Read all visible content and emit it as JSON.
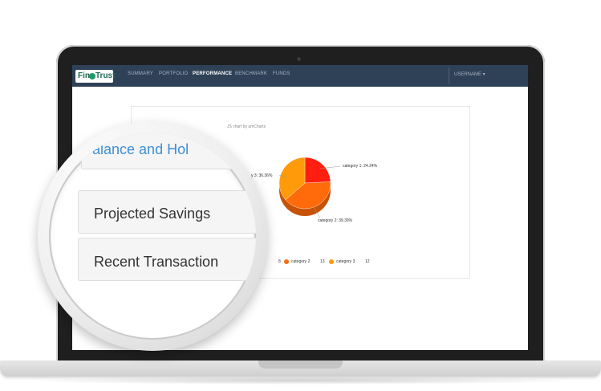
{
  "app": {
    "logo": {
      "left": "Fin",
      "right": "Trust"
    }
  },
  "nav": {
    "items": [
      "SUMMARY",
      "PORTFOLIO",
      "PERFORMANCE",
      "BENCHMARK",
      "FUNDS"
    ],
    "active": "PERFORMANCE",
    "user": "USERNAME ▾"
  },
  "chart": {
    "credit": "JS chart by amCharts",
    "labels": {
      "category1": "category 1: 24.24%",
      "category2": "category 2: 39.39%",
      "category3": "y 3: 36.36%"
    },
    "legend": {
      "value1": "8",
      "category2": "category 2",
      "value2": "13",
      "category3": "category 3",
      "value3": "12"
    }
  },
  "chart_data": {
    "type": "pie",
    "categories": [
      "category 1",
      "category 2",
      "category 3"
    ],
    "values": [
      24.24,
      39.39,
      36.36
    ],
    "colors": [
      "#ff1e0f",
      "#ff6a0a",
      "#ff9a0a"
    ]
  },
  "magnifier": {
    "title": "alance and Hol",
    "items": [
      "Projected Savings",
      "Recent Transaction"
    ]
  }
}
